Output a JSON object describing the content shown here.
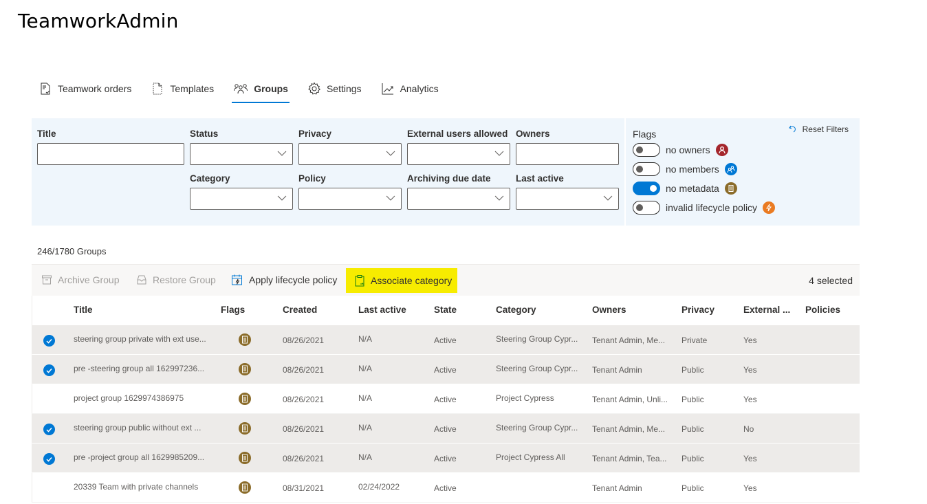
{
  "app": {
    "title": "TeamworkAdmin"
  },
  "tabs": [
    {
      "label": "Teamwork orders",
      "icon": "document-icon",
      "active": false
    },
    {
      "label": "Templates",
      "icon": "template-icon",
      "active": false
    },
    {
      "label": "Groups",
      "icon": "people-icon",
      "active": true
    },
    {
      "label": "Settings",
      "icon": "gear-icon",
      "active": false
    },
    {
      "label": "Analytics",
      "icon": "chart-icon",
      "active": false
    }
  ],
  "filters": {
    "title": {
      "label": "Title",
      "value": ""
    },
    "status": {
      "label": "Status",
      "value": ""
    },
    "privacy": {
      "label": "Privacy",
      "value": ""
    },
    "external_users": {
      "label": "External users allowed",
      "value": ""
    },
    "owners": {
      "label": "Owners",
      "value": ""
    },
    "category": {
      "label": "Category",
      "value": ""
    },
    "policy": {
      "label": "Policy",
      "value": ""
    },
    "archiving_due_date": {
      "label": "Archiving due date",
      "value": ""
    },
    "last_active": {
      "label": "Last active",
      "value": ""
    },
    "flags": {
      "label": "Flags",
      "reset_label": "Reset Filters",
      "items": [
        {
          "label": "no owners",
          "on": false,
          "icon": "no-owner-icon",
          "color": "#a4262c"
        },
        {
          "label": "no members",
          "on": false,
          "icon": "no-members-icon",
          "color": "#0078d4"
        },
        {
          "label": "no metadata",
          "on": true,
          "icon": "no-metadata-icon",
          "color": "#8b6c2a"
        },
        {
          "label": "invalid lifecycle policy",
          "on": false,
          "icon": "invalid-policy-icon",
          "color": "#ea7b22"
        }
      ]
    }
  },
  "count": "246/1780 Groups",
  "commands": {
    "archive": "Archive Group",
    "restore": "Restore Group",
    "apply_policy": "Apply lifecycle policy",
    "associate_category": "Associate category",
    "selected": "4 selected"
  },
  "colors": {
    "accent": "#0078d4",
    "highlight": "#f7ec00",
    "filter_bg": "#eff6fc",
    "metadata_flag": "#8b6c2a"
  },
  "table": {
    "columns": [
      "Title",
      "Flags",
      "Created",
      "Last active",
      "State",
      "Category",
      "Owners",
      "Privacy",
      "External ...",
      "Policies"
    ],
    "rows": [
      {
        "selected": true,
        "title": "steering group private with ext use...",
        "flag": "no-metadata",
        "created": "08/26/2021",
        "last_active": "N/A",
        "state": "Active",
        "category": "Steering Group Cypr...",
        "owners": "Tenant Admin, Me...",
        "privacy": "Private",
        "external": "Yes",
        "policies": ""
      },
      {
        "selected": true,
        "title": "pre -steering group all 162997236...",
        "flag": "no-metadata",
        "created": "08/26/2021",
        "last_active": "N/A",
        "state": "Active",
        "category": "Steering Group Cypr...",
        "owners": "Tenant Admin",
        "privacy": "Public",
        "external": "Yes",
        "policies": ""
      },
      {
        "selected": false,
        "title": "project group 1629974386975",
        "flag": "no-metadata",
        "created": "08/26/2021",
        "last_active": "N/A",
        "state": "Active",
        "category": "Project Cypress",
        "owners": "Tenant Admin, Unli...",
        "privacy": "Public",
        "external": "Yes",
        "policies": ""
      },
      {
        "selected": true,
        "title": "steering group public without ext ...",
        "flag": "no-metadata",
        "created": "08/26/2021",
        "last_active": "N/A",
        "state": "Active",
        "category": "Steering Group Cypr...",
        "owners": "Tenant Admin, Me...",
        "privacy": "Public",
        "external": "No",
        "policies": ""
      },
      {
        "selected": true,
        "title": "pre -project group all 1629985209...",
        "flag": "no-metadata",
        "created": "08/26/2021",
        "last_active": "N/A",
        "state": "Active",
        "category": "Project Cypress All",
        "owners": "Tenant Admin, Tea...",
        "privacy": "Public",
        "external": "Yes",
        "policies": ""
      },
      {
        "selected": false,
        "title": "20339 Team with private channels",
        "flag": "no-metadata",
        "created": "08/31/2021",
        "last_active": "02/24/2022",
        "state": "Active",
        "category": "",
        "owners": "Tenant Admin",
        "privacy": "Public",
        "external": "Yes",
        "policies": ""
      }
    ]
  }
}
